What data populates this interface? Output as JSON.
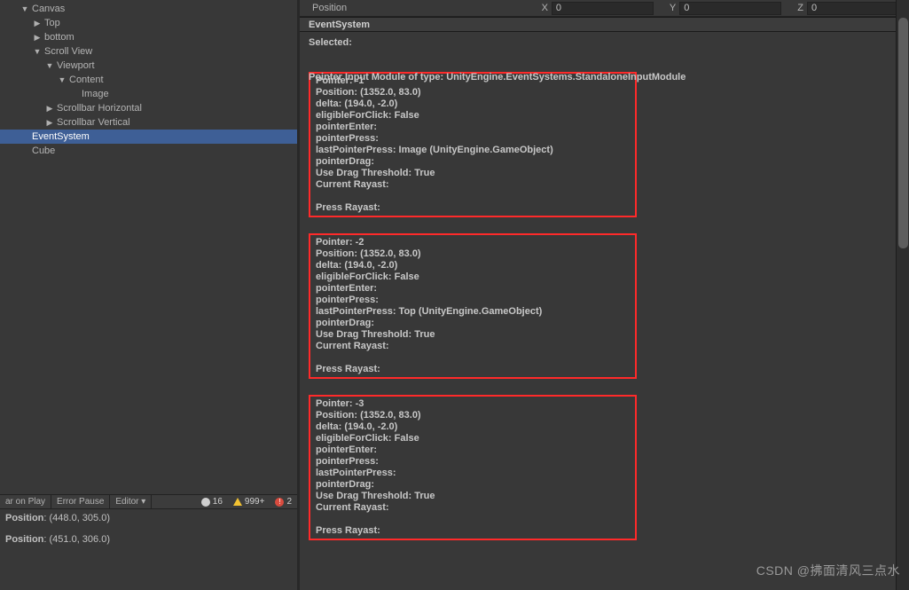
{
  "hierarchy": {
    "items": [
      {
        "label": "Canvas",
        "depth": 0,
        "expanded": true,
        "hasChildren": true,
        "selected": false
      },
      {
        "label": "Top",
        "depth": 1,
        "expanded": false,
        "hasChildren": true,
        "selected": false
      },
      {
        "label": "bottom",
        "depth": 1,
        "expanded": false,
        "hasChildren": true,
        "selected": false
      },
      {
        "label": "Scroll View",
        "depth": 1,
        "expanded": true,
        "hasChildren": true,
        "selected": false
      },
      {
        "label": "Viewport",
        "depth": 2,
        "expanded": true,
        "hasChildren": true,
        "selected": false
      },
      {
        "label": "Content",
        "depth": 3,
        "expanded": true,
        "hasChildren": true,
        "selected": false
      },
      {
        "label": "Image",
        "depth": 4,
        "expanded": false,
        "hasChildren": false,
        "selected": false
      },
      {
        "label": "Scrollbar Horizontal",
        "depth": 2,
        "expanded": false,
        "hasChildren": true,
        "selected": false
      },
      {
        "label": "Scrollbar Vertical",
        "depth": 2,
        "expanded": false,
        "hasChildren": true,
        "selected": false
      },
      {
        "label": "EventSystem",
        "depth": 0,
        "expanded": false,
        "hasChildren": false,
        "selected": true
      },
      {
        "label": "Cube",
        "depth": 0,
        "expanded": false,
        "hasChildren": false,
        "selected": false
      }
    ]
  },
  "console": {
    "buttons": {
      "aronplay": "ar on Play",
      "errorpause": "Error Pause",
      "editor": "Editor  ▾"
    },
    "counts": {
      "info": "16",
      "warn": "999+",
      "error": "2"
    },
    "logs": [
      {
        "label": "Position",
        "value": "(448.0, 305.0)"
      },
      {
        "label": "Position",
        "value": "(451.0, 306.0)"
      }
    ]
  },
  "position_row": {
    "label": "Position",
    "x_label": "X",
    "x_value": "0",
    "y_label": "Y",
    "y_value": "0",
    "z_label": "Z",
    "z_value": "0"
  },
  "component_header": "EventSystem",
  "info": {
    "selected_label": "Selected:",
    "selected_value": "",
    "module_line": "Pointer Input Module of type: UnityEngine.EventSystems.StandaloneInputModule"
  },
  "pointers": [
    {
      "id": "-1",
      "position": "(1352.0, 83.0)",
      "delta": "(194.0, -2.0)",
      "eligibleForClick": "False",
      "pointerEnter": "",
      "pointerPress": "",
      "lastPointerPress": "Image (UnityEngine.GameObject)",
      "pointerDrag": "",
      "useDragThreshold": "True",
      "currentRaycast": "",
      "pressRaycast": ""
    },
    {
      "id": "-2",
      "position": "(1352.0, 83.0)",
      "delta": "(194.0, -2.0)",
      "eligibleForClick": "False",
      "pointerEnter": "",
      "pointerPress": "",
      "lastPointerPress": "Top (UnityEngine.GameObject)",
      "pointerDrag": "",
      "useDragThreshold": "True",
      "currentRaycast": "",
      "pressRaycast": ""
    },
    {
      "id": "-3",
      "position": "(1352.0, 83.0)",
      "delta": "(194.0, -2.0)",
      "eligibleForClick": "False",
      "pointerEnter": "",
      "pointerPress": "",
      "lastPointerPress": "",
      "pointerDrag": "",
      "useDragThreshold": "True",
      "currentRaycast": "",
      "pressRaycast": ""
    }
  ],
  "ptr_labels": {
    "pointer": "Pointer: ",
    "position": "Position: ",
    "delta": "delta: ",
    "eligible": "eligibleForClick: ",
    "enter": "pointerEnter:",
    "press": "pointerPress:",
    "lastpress": "lastPointerPress: ",
    "drag": "pointerDrag:",
    "threshold": "Use Drag Threshold: ",
    "curray": "Current Rayast:",
    "pressray": "Press Rayast:"
  },
  "watermark": "CSDN @拂面清风三点水"
}
